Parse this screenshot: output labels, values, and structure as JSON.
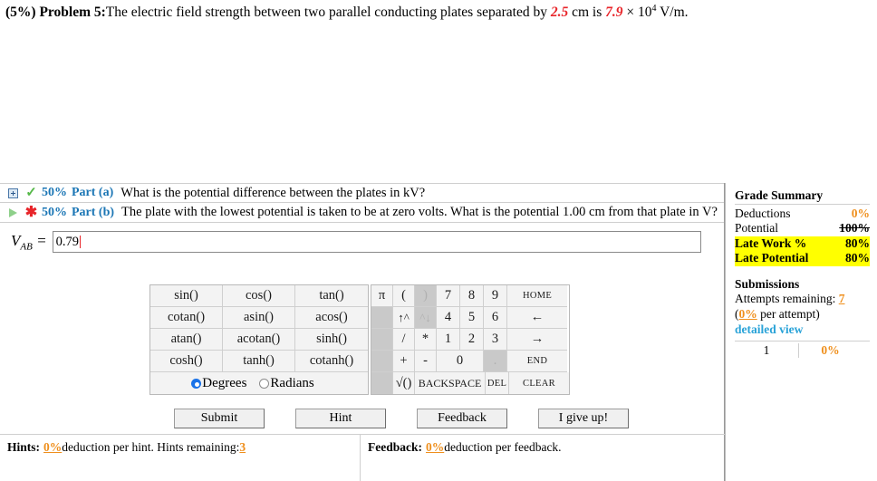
{
  "problem": {
    "weight": "(5%)",
    "label": "Problem 5:",
    "text_1": "The electric field strength between two parallel conducting plates separated by ",
    "value_1": "2.5",
    "text_2": " cm is ",
    "value_2": "7.9",
    "text_3": " × 10",
    "exponent": "4",
    "text_4": " V/m."
  },
  "parts": [
    {
      "expand_icon": "expand-plus-icon",
      "status_icon": "green-check-icon",
      "percent": "50%",
      "label": "Part (a)",
      "text": "What is the potential difference between the plates in kV?"
    },
    {
      "expand_icon": "play-triangle-icon",
      "status_icon": "red-star-icon",
      "percent": "50%",
      "label": "Part (b)",
      "text": "The plate with the lowest potential is taken to be at zero volts. What is the potential 1.00 cm from that plate in V?"
    }
  ],
  "answer": {
    "variable": "V",
    "subscript": "AB",
    "equals": "=",
    "value": "0.79",
    "placeholder": ""
  },
  "calculator": {
    "trig_rows": [
      [
        "sin()",
        "cos()",
        "tan()"
      ],
      [
        "cotan()",
        "asin()",
        "acos()"
      ],
      [
        "atan()",
        "acotan()",
        "sinh()"
      ],
      [
        "cosh()",
        "tanh()",
        "cotanh()"
      ]
    ],
    "angle_mode": {
      "selected": "Degrees",
      "options": [
        "Degrees",
        "Radians"
      ]
    },
    "num_rows": [
      [
        "π",
        "(",
        ")",
        "7",
        "8",
        "9",
        "HOME"
      ],
      [
        "",
        "↑^",
        "^↓",
        "4",
        "5",
        "6",
        "←"
      ],
      [
        "",
        "/",
        "*",
        "1",
        "2",
        "3",
        "→"
      ],
      [
        "",
        "+",
        "-",
        "0",
        ".",
        "END"
      ],
      [
        "",
        "√()",
        "BACKSPACE",
        "DEL",
        "CLEAR"
      ]
    ],
    "disabled_keys": [
      ")",
      "^↓",
      "."
    ]
  },
  "action_buttons": [
    {
      "label": "Submit",
      "name": "submit-button"
    },
    {
      "label": "Hint",
      "name": "hint-button"
    },
    {
      "label": "Feedback",
      "name": "feedback-button"
    },
    {
      "label": "I give up!",
      "name": "give-up-button"
    }
  ],
  "footer": {
    "hints_label": "Hints:",
    "hints_deduction": "0%",
    "hints_text_1": " deduction per hint. Hints remaining: ",
    "hints_remaining": "3",
    "feedback_label": "Feedback:",
    "feedback_deduction": "0%",
    "feedback_text": " deduction per feedback."
  },
  "sidebar": {
    "grade_title": "Grade Summary",
    "rows": [
      {
        "label": "Deductions",
        "value": "0%"
      },
      {
        "label": "Potential",
        "value": "100%"
      },
      {
        "label": "Late Work %",
        "value": "80%"
      },
      {
        "label": "Late Potential",
        "value": "80%"
      }
    ],
    "submissions_title": "Submissions",
    "attempts_label": "Attempts remaining: ",
    "attempts_value": "7",
    "per_attempt_value": "0%",
    "per_attempt_text": " per attempt)",
    "per_attempt_open": "(",
    "detailed_view": "detailed view",
    "attempt_table": [
      {
        "num": "1",
        "pct": "0%"
      }
    ]
  },
  "colors": {
    "accent_blue": "#1b76b5",
    "orange": "#ef8f1c",
    "red": "#e8252a",
    "highlight": "#ffff00",
    "link": "#2aa3d8"
  }
}
